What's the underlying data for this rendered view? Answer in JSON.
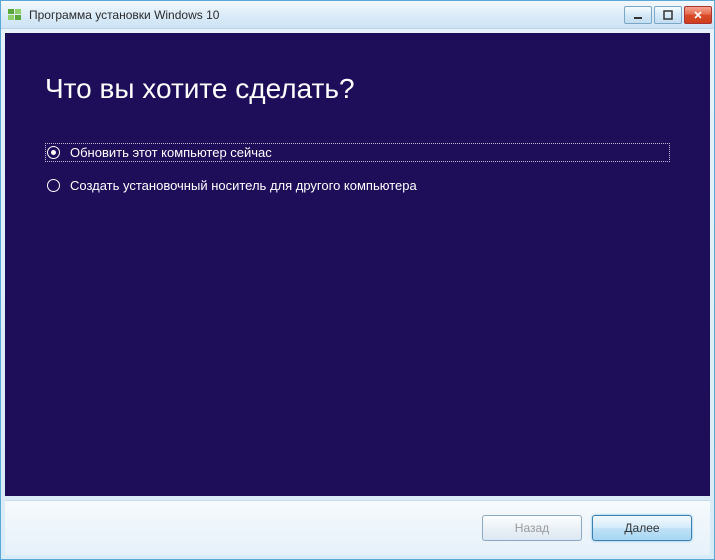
{
  "window": {
    "title": "Программа установки Windows 10"
  },
  "main": {
    "heading": "Что вы хотите сделать?",
    "options": [
      {
        "label": "Обновить этот компьютер сейчас",
        "selected": true
      },
      {
        "label": "Создать установочный носитель для другого компьютера",
        "selected": false
      }
    ]
  },
  "footer": {
    "back_label": "Назад",
    "next_label": "Далее"
  }
}
